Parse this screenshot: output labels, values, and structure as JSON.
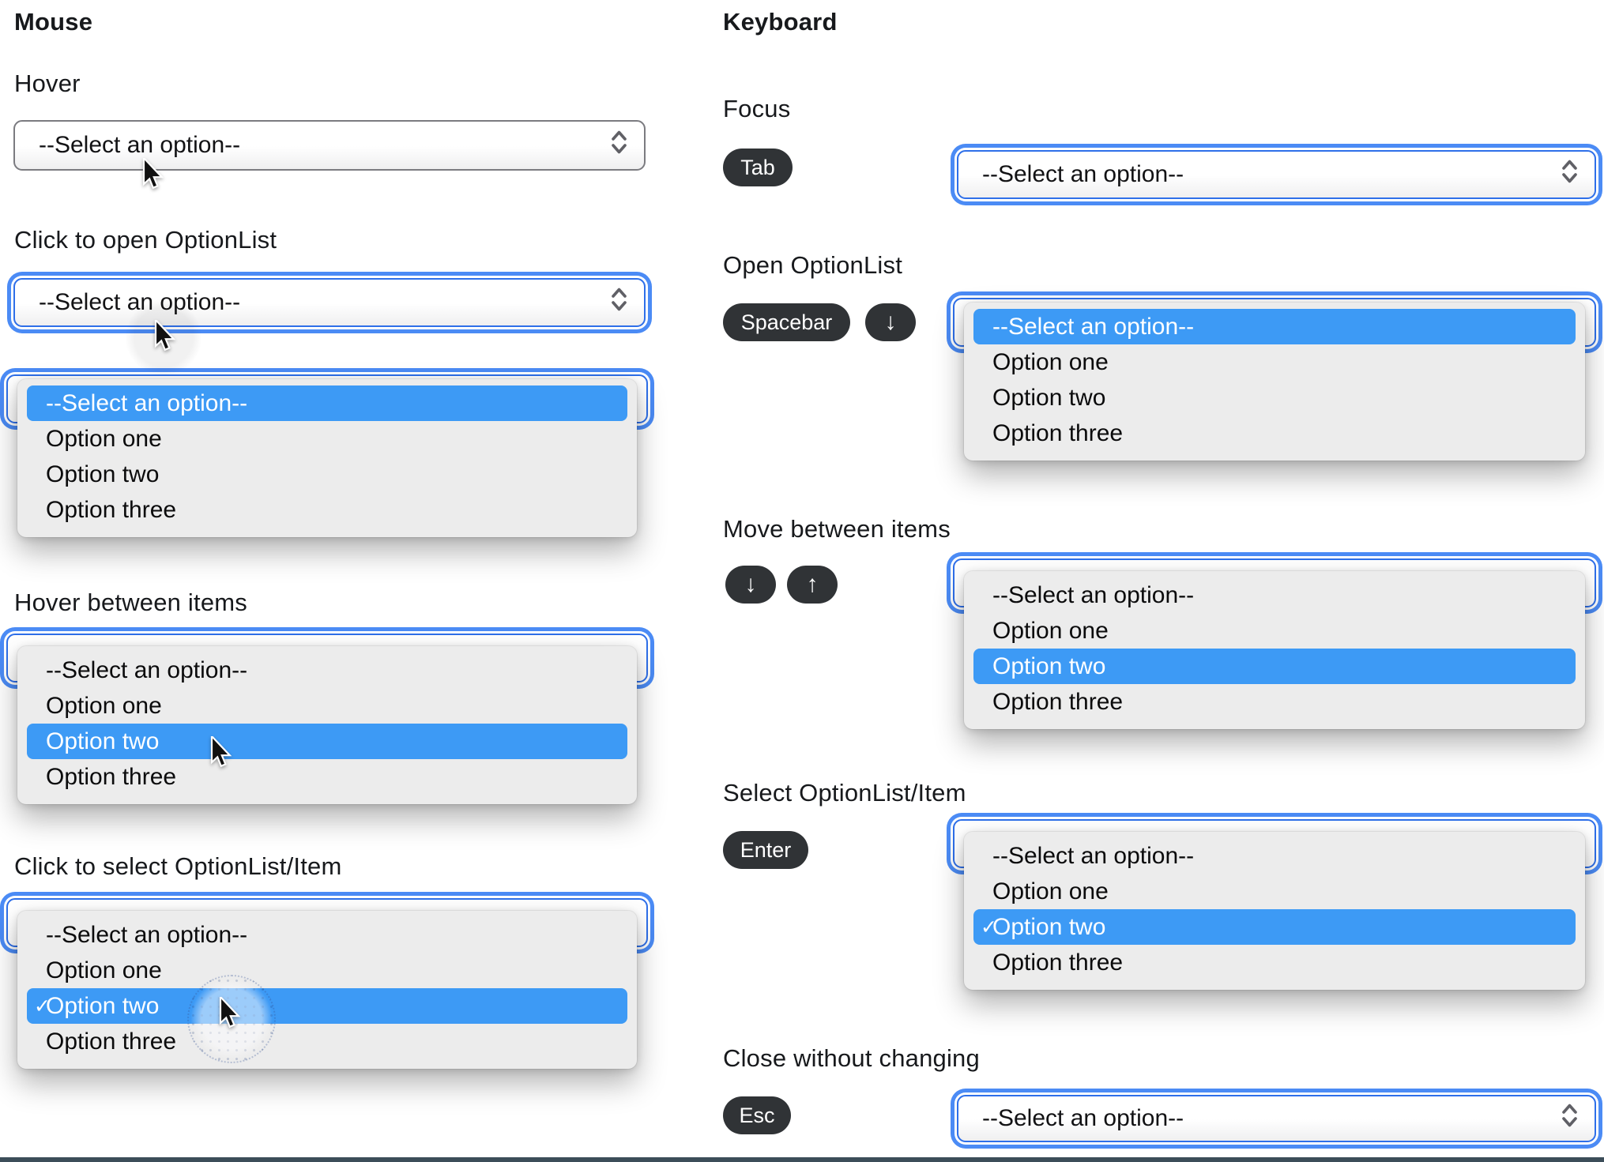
{
  "page": {
    "background": "#ffffff",
    "bottom_rule_color": "#3c4d59"
  },
  "colors": {
    "focus_ring_blue": "#4b8bf5",
    "focus_border_blue": "#2e6fe9",
    "highlight_blue": "#3d9af5",
    "panel_gray": "#ececec",
    "badge_dark": "#303336",
    "select_border_gray": "#7b7b80"
  },
  "select": {
    "placeholder": "--Select an option--"
  },
  "options": [
    "--Select an option--",
    "Option one",
    "Option two",
    "Option three"
  ],
  "checkmark": "✓",
  "icons": {
    "stepper": "up-down-chevrons",
    "cursor": "mouse-pointer",
    "halo": "click-indicator"
  },
  "left": {
    "title": "Mouse",
    "hover_heading": "Hover",
    "open_heading": "Click to open OptionList",
    "move_heading": "Hover between items",
    "select_heading": "Click to select OptionList/Item"
  },
  "right": {
    "title": "Keyboard",
    "focus_heading": "Focus",
    "open_heading": "Open OptionList",
    "move_heading": "Move between items",
    "select_heading": "Select OptionList/Item",
    "close_heading": "Close without changing"
  },
  "keys": {
    "tab": "Tab",
    "spacebar": "Spacebar",
    "enter": "Enter",
    "esc": "Esc",
    "arrow_down": "↓",
    "arrow_up": "↑"
  }
}
